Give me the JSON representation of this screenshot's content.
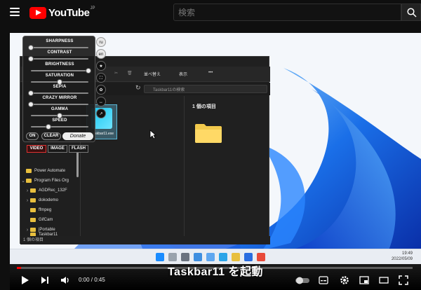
{
  "header": {
    "logo_text": "YouTube",
    "logo_region": "JP",
    "search_placeholder": "検索"
  },
  "explorer": {
    "toolbar_sort": "並べ替え",
    "toolbar_view": "表示",
    "toolbar_more": "•••",
    "search_placeholder": "Taskbar11の検索",
    "nav_items": [
      {
        "label": "Power Automate"
      },
      {
        "label": "Program Files Org"
      },
      {
        "label": "AGDRec_132F"
      },
      {
        "label": "dokodemo"
      },
      {
        "label": "ffmpeg"
      },
      {
        "label": "GifCam"
      },
      {
        "label": "jPortable"
      },
      {
        "label": "Taskbar11"
      }
    ],
    "file_name": "Taskbar11.exe",
    "preview_title": "1 個の項目",
    "status": "1 個の項目"
  },
  "extension": {
    "sliders": [
      {
        "label": "SHARPNESS",
        "level": 0.0
      },
      {
        "label": "CONTRAST",
        "level": 0.0
      },
      {
        "label": "BRIGHTNESS",
        "level": 1.0
      },
      {
        "label": "SATURATION",
        "level": 0.5
      },
      {
        "label": "SEPIA",
        "level": 0.0
      },
      {
        "label": "CRAZY MIRROR",
        "level": 0.0
      },
      {
        "label": "GAMMA",
        "level": 0.5
      },
      {
        "label": "SPEED",
        "level": 0.3
      }
    ],
    "on_label": "ON",
    "clear_label": "CLEAR",
    "donate_label": "Donate",
    "tabs": [
      "VIDEO",
      "IMAGE",
      "FLASH"
    ],
    "side_buttons": [
      "ru",
      "en"
    ]
  },
  "screen": {
    "tray_time": "19:49",
    "tray_date": "2022/05/09"
  },
  "subtitle": "Taskbar11 を起動",
  "player": {
    "time": "0:00 / 0:45",
    "progress": 0.01,
    "accent": "#ff0000"
  }
}
